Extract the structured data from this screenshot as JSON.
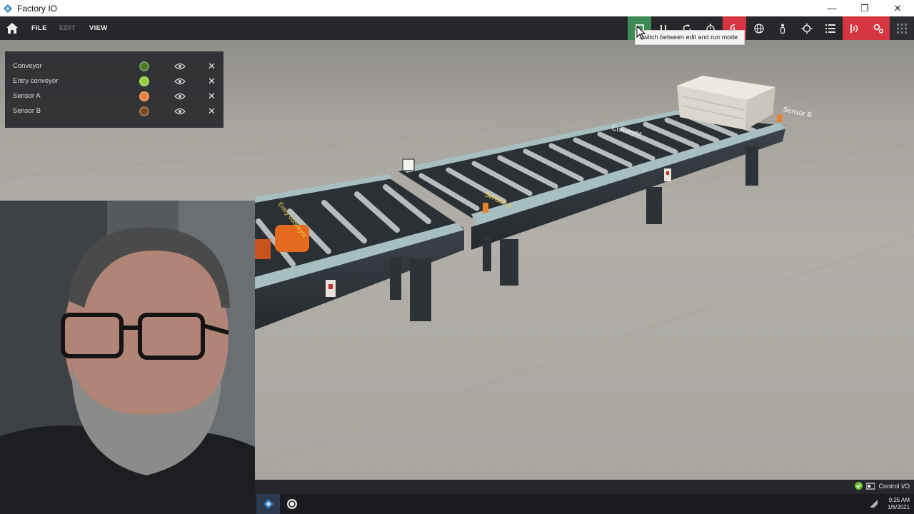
{
  "window": {
    "title": "Factory IO",
    "minimize": "—",
    "restore": "❐",
    "close": "✕"
  },
  "menu": {
    "file": "FILE",
    "edit": "EDIT",
    "view": "VIEW"
  },
  "toolbar": {
    "items": [
      {
        "name": "edit-run-toggle",
        "icon": "square-icon"
      },
      {
        "name": "pause",
        "icon": "pause-icon"
      },
      {
        "name": "reset",
        "icon": "reset-icon"
      },
      {
        "name": "timer",
        "icon": "stopwatch-icon"
      },
      {
        "name": "camera-orbit",
        "icon": "camera-icon"
      },
      {
        "name": "global",
        "icon": "globe-icon"
      },
      {
        "name": "first-person",
        "icon": "person-icon"
      },
      {
        "name": "target",
        "icon": "crosshair-icon"
      },
      {
        "name": "tags-list",
        "icon": "list-icon"
      },
      {
        "name": "sensors",
        "icon": "sensor-icon"
      },
      {
        "name": "drivers",
        "icon": "gears-icon"
      },
      {
        "name": "palette",
        "icon": "grid-icon"
      }
    ],
    "tooltip": "Switch between edit and run mode"
  },
  "tags": [
    {
      "label": "Conveyor",
      "state_color": "#4a7a2e"
    },
    {
      "label": "Entry conveyor",
      "state_color": "#8fd13b"
    },
    {
      "label": "Sensor A",
      "state_color": "#e8803b"
    },
    {
      "label": "Sensor B",
      "state_color": "#7a4a25"
    }
  ],
  "scene_labels": {
    "sensor_a": "Sensor A",
    "sensor_b": "Sensor B",
    "conveyor": "Conveyor",
    "entry_conveyor": "Entry conveyor"
  },
  "status": {
    "controller": "Control I/O"
  },
  "taskbar": {
    "time": "9:25 AM",
    "date": "1/6/2021"
  },
  "colors": {
    "accent_green": "#3e8a55",
    "accent_red": "#d5353f",
    "panel_bg": "#26282b"
  }
}
